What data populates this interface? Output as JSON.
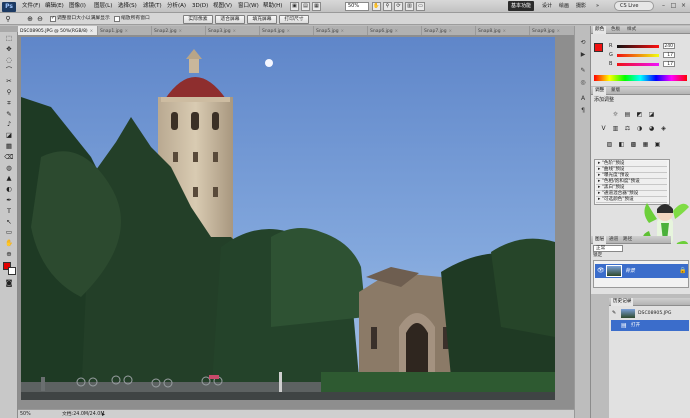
{
  "menubar": {
    "app_logo": "Ps",
    "items": [
      "文件(F)",
      "编辑(E)",
      "图像(I)",
      "图层(L)",
      "选择(S)",
      "滤镜(T)",
      "分析(A)",
      "3D(D)",
      "视图(V)",
      "窗口(W)",
      "帮助(H)"
    ],
    "zoom_value": "50%",
    "workspaces": [
      "基本功能",
      "设计",
      "绘画",
      "摄影"
    ],
    "more": "»",
    "cs_live": "CS Live",
    "window_controls": [
      "–",
      "□",
      "×"
    ]
  },
  "options": {
    "resize_windows": "调整窗口大小以满屏显示",
    "zoom_all": "缩放所有窗口",
    "buttons": [
      "实际像素",
      "适合屏幕",
      "填充屏幕",
      "打印尺寸"
    ]
  },
  "tabs": [
    {
      "label": "DSC08905.JPG @ 50%(RGB/8)",
      "active": true
    },
    {
      "label": "Snap1.jpg",
      "active": false
    },
    {
      "label": "Snap2.jpg",
      "active": false
    },
    {
      "label": "Snap3.jpg",
      "active": false
    },
    {
      "label": "Snap4.jpg",
      "active": false
    },
    {
      "label": "Snap5.jpg",
      "active": false
    },
    {
      "label": "Snap6.jpg",
      "active": false
    },
    {
      "label": "Snap7.jpg",
      "active": false
    },
    {
      "label": "Snap8.jpg",
      "active": false
    },
    {
      "label": "Snap9.jpg",
      "active": false
    }
  ],
  "tab_close": "×",
  "tools": [
    "⬚",
    "✥",
    "◌",
    "⌒",
    "✂",
    "⚲",
    "⌗",
    "✎",
    "♪",
    "◪",
    "▦",
    "⌫",
    "◍",
    "▲",
    "◐",
    "✒",
    "T",
    "↖",
    "▭",
    "✋",
    "⊕"
  ],
  "status": {
    "zoom": "50%",
    "doc": "文档:24.0M/24.0M"
  },
  "color_panel": {
    "tabs": [
      "颜色",
      "色板",
      "样式"
    ],
    "channels": [
      {
        "label": "R",
        "value": "240",
        "color": "#e00000"
      },
      {
        "label": "G",
        "value": "17",
        "color": "#00c000"
      },
      {
        "label": "B",
        "value": "17",
        "color": "#0030ff"
      }
    ],
    "fg_color": "#f01111"
  },
  "adjust_panel": {
    "tabs": [
      "调整",
      "蒙版"
    ],
    "title": "添加调整",
    "icons_row1": [
      "☼",
      "▤",
      "◩",
      "◪"
    ],
    "icons_row2": [
      "V",
      "▥",
      "⚖",
      "◑",
      "◕",
      "◈"
    ],
    "icons_row3": [
      "▨",
      "◧",
      "▩",
      "▦",
      "▣"
    ],
    "presets": [
      "\"色阶\"预设",
      "\"曲线\"预设",
      "\"曝光度\"预设",
      "\"色相/饱和度\"预设",
      "\"黑白\"预设",
      "\"通道混合器\"预设",
      "\"可选颜色\"预设"
    ]
  },
  "layers_panel": {
    "tabs": [
      "图层",
      "通道",
      "路径"
    ],
    "blend_mode": "正常",
    "opacity": "100%",
    "lock": "锁定",
    "layer_name": "背景"
  },
  "history_panel": {
    "tab": "历史记录",
    "snapshot": "DSC08905.JPG",
    "steps": [
      "打开"
    ]
  }
}
